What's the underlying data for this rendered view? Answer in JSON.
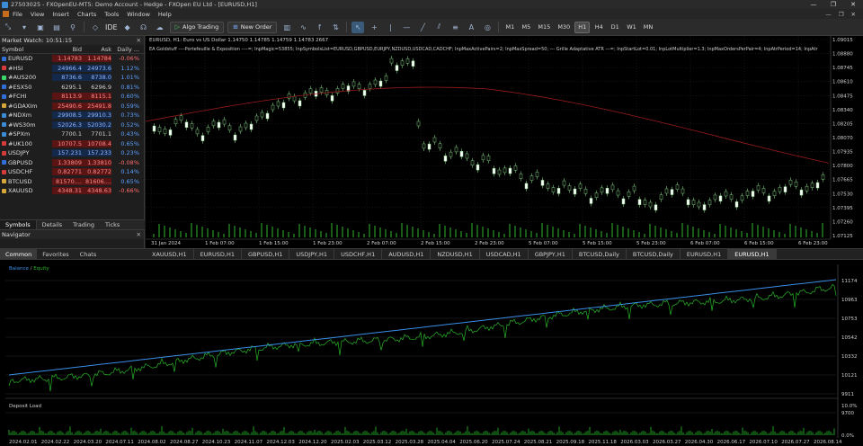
{
  "window": {
    "title": "27503025 - FXOpenEU-MT5: Demo Account - Hedge - FXOpen EU Ltd - [EURUSD,H1]",
    "controls": [
      "—",
      "❐",
      "✕"
    ]
  },
  "menu": {
    "items": [
      "File",
      "View",
      "Insert",
      "Charts",
      "Tools",
      "Window",
      "Help"
    ],
    "right": [
      "—",
      "❐",
      "✕"
    ]
  },
  "toolbar": {
    "ide_label": "IDE",
    "algo_label": "Algo Trading",
    "order_label": "New Order",
    "timeframes": [
      "M1",
      "M5",
      "M15",
      "M30",
      "H1",
      "H4",
      "D1",
      "W1",
      "MN"
    ],
    "active_tf": "H1"
  },
  "market_watch": {
    "title": "Market Watch: 10:51:15",
    "headers": {
      "symbol": "Symbol",
      "bid": "Bid",
      "ask": "Ask",
      "change": "Daily ..."
    },
    "rows": [
      {
        "symbol": "EURUSD",
        "bid": "1.14783",
        "ask": "1.14784",
        "change": "-0.06%",
        "color": "red",
        "icon": "#2f6fd6"
      },
      {
        "symbol": "#HSI",
        "bid": "24966.4",
        "ask": "24973.6",
        "change": "1.12%",
        "color": "blue",
        "icon": "#d63b3b"
      },
      {
        "symbol": "#AUS200",
        "bid": "8736.6",
        "ask": "8738.0",
        "change": "1.01%",
        "color": "blue",
        "icon": "#3bd66b"
      },
      {
        "symbol": "#ESX50",
        "bid": "6295.1",
        "ask": "6296.9",
        "change": "0.81%",
        "color": "none",
        "icon": "#2f6fd6"
      },
      {
        "symbol": "#FCHI",
        "bid": "8113.9",
        "ask": "8115.1",
        "change": "0.60%",
        "color": "red",
        "icon": "#2f6fd6"
      },
      {
        "symbol": "#GDAXIm",
        "bid": "25490.6",
        "ask": "25491.8",
        "change": "0.59%",
        "color": "red",
        "icon": "#d6a63b"
      },
      {
        "symbol": "#NDXm",
        "bid": "29908.5",
        "ask": "29910.3",
        "change": "0.73%",
        "color": "blue",
        "icon": "#3b8bd6"
      },
      {
        "symbol": "#WS30m",
        "bid": "52026.3",
        "ask": "52030.2",
        "change": "0.52%",
        "color": "blue",
        "icon": "#3b8bd6"
      },
      {
        "symbol": "#SPXm",
        "bid": "7700.1",
        "ask": "7701.1",
        "change": "0.43%",
        "color": "none",
        "icon": "#3b8bd6"
      },
      {
        "symbol": "#UK100",
        "bid": "10707.5",
        "ask": "10708.4",
        "change": "0.65%",
        "color": "red",
        "icon": "#d63b3b"
      },
      {
        "symbol": "USDJPY",
        "bid": "157.231",
        "ask": "157.233",
        "change": "0.23%",
        "color": "blue",
        "icon": "#d63b3b"
      },
      {
        "symbol": "GBPUSD",
        "bid": "1.33809",
        "ask": "1.33810",
        "change": "-0.08%",
        "color": "red",
        "icon": "#2f6fd6"
      },
      {
        "symbol": "USDCHF",
        "bid": "0.82771",
        "ask": "0.82772",
        "change": "0.14%",
        "color": "red",
        "icon": "#d63b3b"
      },
      {
        "symbol": "BTCUSD",
        "bid": "81570....",
        "ask": "81606....",
        "change": "0.65%",
        "color": "red",
        "icon": "#d6a63b"
      },
      {
        "symbol": "XAUUSD",
        "bid": "4348.31",
        "ask": "4348.63",
        "change": "-0.66%",
        "color": "red",
        "icon": "#d6a63b"
      }
    ],
    "tabs": [
      "Symbols",
      "Details",
      "Trading",
      "Ticks"
    ]
  },
  "navigator": {
    "title": "Navigator"
  },
  "chart": {
    "info": "EURUSD, H1:  Euro vs US Dollar  1.14750  1.14785  1.14759  1.14783  2667",
    "ea_line": "EA Goldstuff  ----Portefeuille & Exposition ----=; InpMagic=53855; InpSymbolsList=EURUSD,GBPUSD,EURJPY,NZDUSD,USDCAD,CADCHF; InpMaxActivePairs=2; InpMaxSpread=50; --- Grille Adaptative ATR ---=; InpStartLot=0.01; InpLotMultiplier=1.3; InpMaxOrdersPerPair=4; InpAtrPeriod=14; InpAtr",
    "price_labels": [
      "1.09015",
      "1.08880",
      "1.08745",
      "1.08610",
      "1.08475",
      "1.08340",
      "1.08205",
      "1.08070",
      "1.07935",
      "1.07800",
      "1.07665",
      "1.07530",
      "1.07395",
      "1.07260",
      "1.07125"
    ],
    "time_labels": [
      "31 Jan 2024",
      "1 Feb 07:00",
      "1 Feb 15:00",
      "1 Feb 23:00",
      "2 Feb 07:00",
      "2 Feb 15:00",
      "2 Feb 23:00",
      "5 Feb 07:00",
      "5 Feb 15:00",
      "5 Feb 23:00",
      "6 Feb 07:00",
      "6 Feb 15:00",
      "6 Feb 23:00"
    ],
    "colors": {
      "bull": "#ffffff",
      "bear": "#ffffff",
      "ma_red": "#9a1b1b",
      "grid": "#2a2a2a",
      "volume": "#2fb82f"
    }
  },
  "chart_tabs": {
    "items": [
      "XAUUSD,H1",
      "EURUSD,H1",
      "GBPUSD,H1",
      "USDJPY,H1",
      "USDCHF,H1",
      "AUDUSD,H1",
      "NZDUSD,H1",
      "USDCAD,H1",
      "GBPJPY,H1",
      "BTCUSD,Daily",
      "BTCUSD,Daily",
      "EURUSD,H1",
      "EURUSD,H1"
    ],
    "active_index": 12
  },
  "bottom_tabs": {
    "items": [
      "Common",
      "Favorites",
      "Chats"
    ],
    "active_index": 0
  },
  "report": {
    "legend_balance": "Balance",
    "legend_sep": " / ",
    "legend_equity": "Equity",
    "deposit_label": "Deposit Load",
    "y_labels": [
      "11174",
      "10963",
      "10753",
      "10542",
      "10332",
      "10121",
      "9911",
      "9700"
    ],
    "load_labels": [
      "10.0%",
      "0.0%"
    ],
    "x_labels": [
      "2024.02.01",
      "2024.02.22",
      "2024.03.20",
      "2024.07.11",
      "2024.08.02",
      "2024.08.27",
      "2024.10.23",
      "2024.11.07",
      "2024.12.03",
      "2024.12.20",
      "2025.02.03",
      "2025.03.12",
      "2025.03.28",
      "2025.04.04",
      "2025.06.20",
      "2025.07.24",
      "2025.08.21",
      "2025.09.18",
      "2025.11.18",
      "2026.03.03",
      "2026.03.27",
      "2026.04.30",
      "2026.06.17",
      "2026.07.10",
      "2026.07.27",
      "2026.08.14"
    ],
    "colors": {
      "balance": "#3a8ee8",
      "equity": "#27b427",
      "load": "#1f9a1f"
    }
  }
}
